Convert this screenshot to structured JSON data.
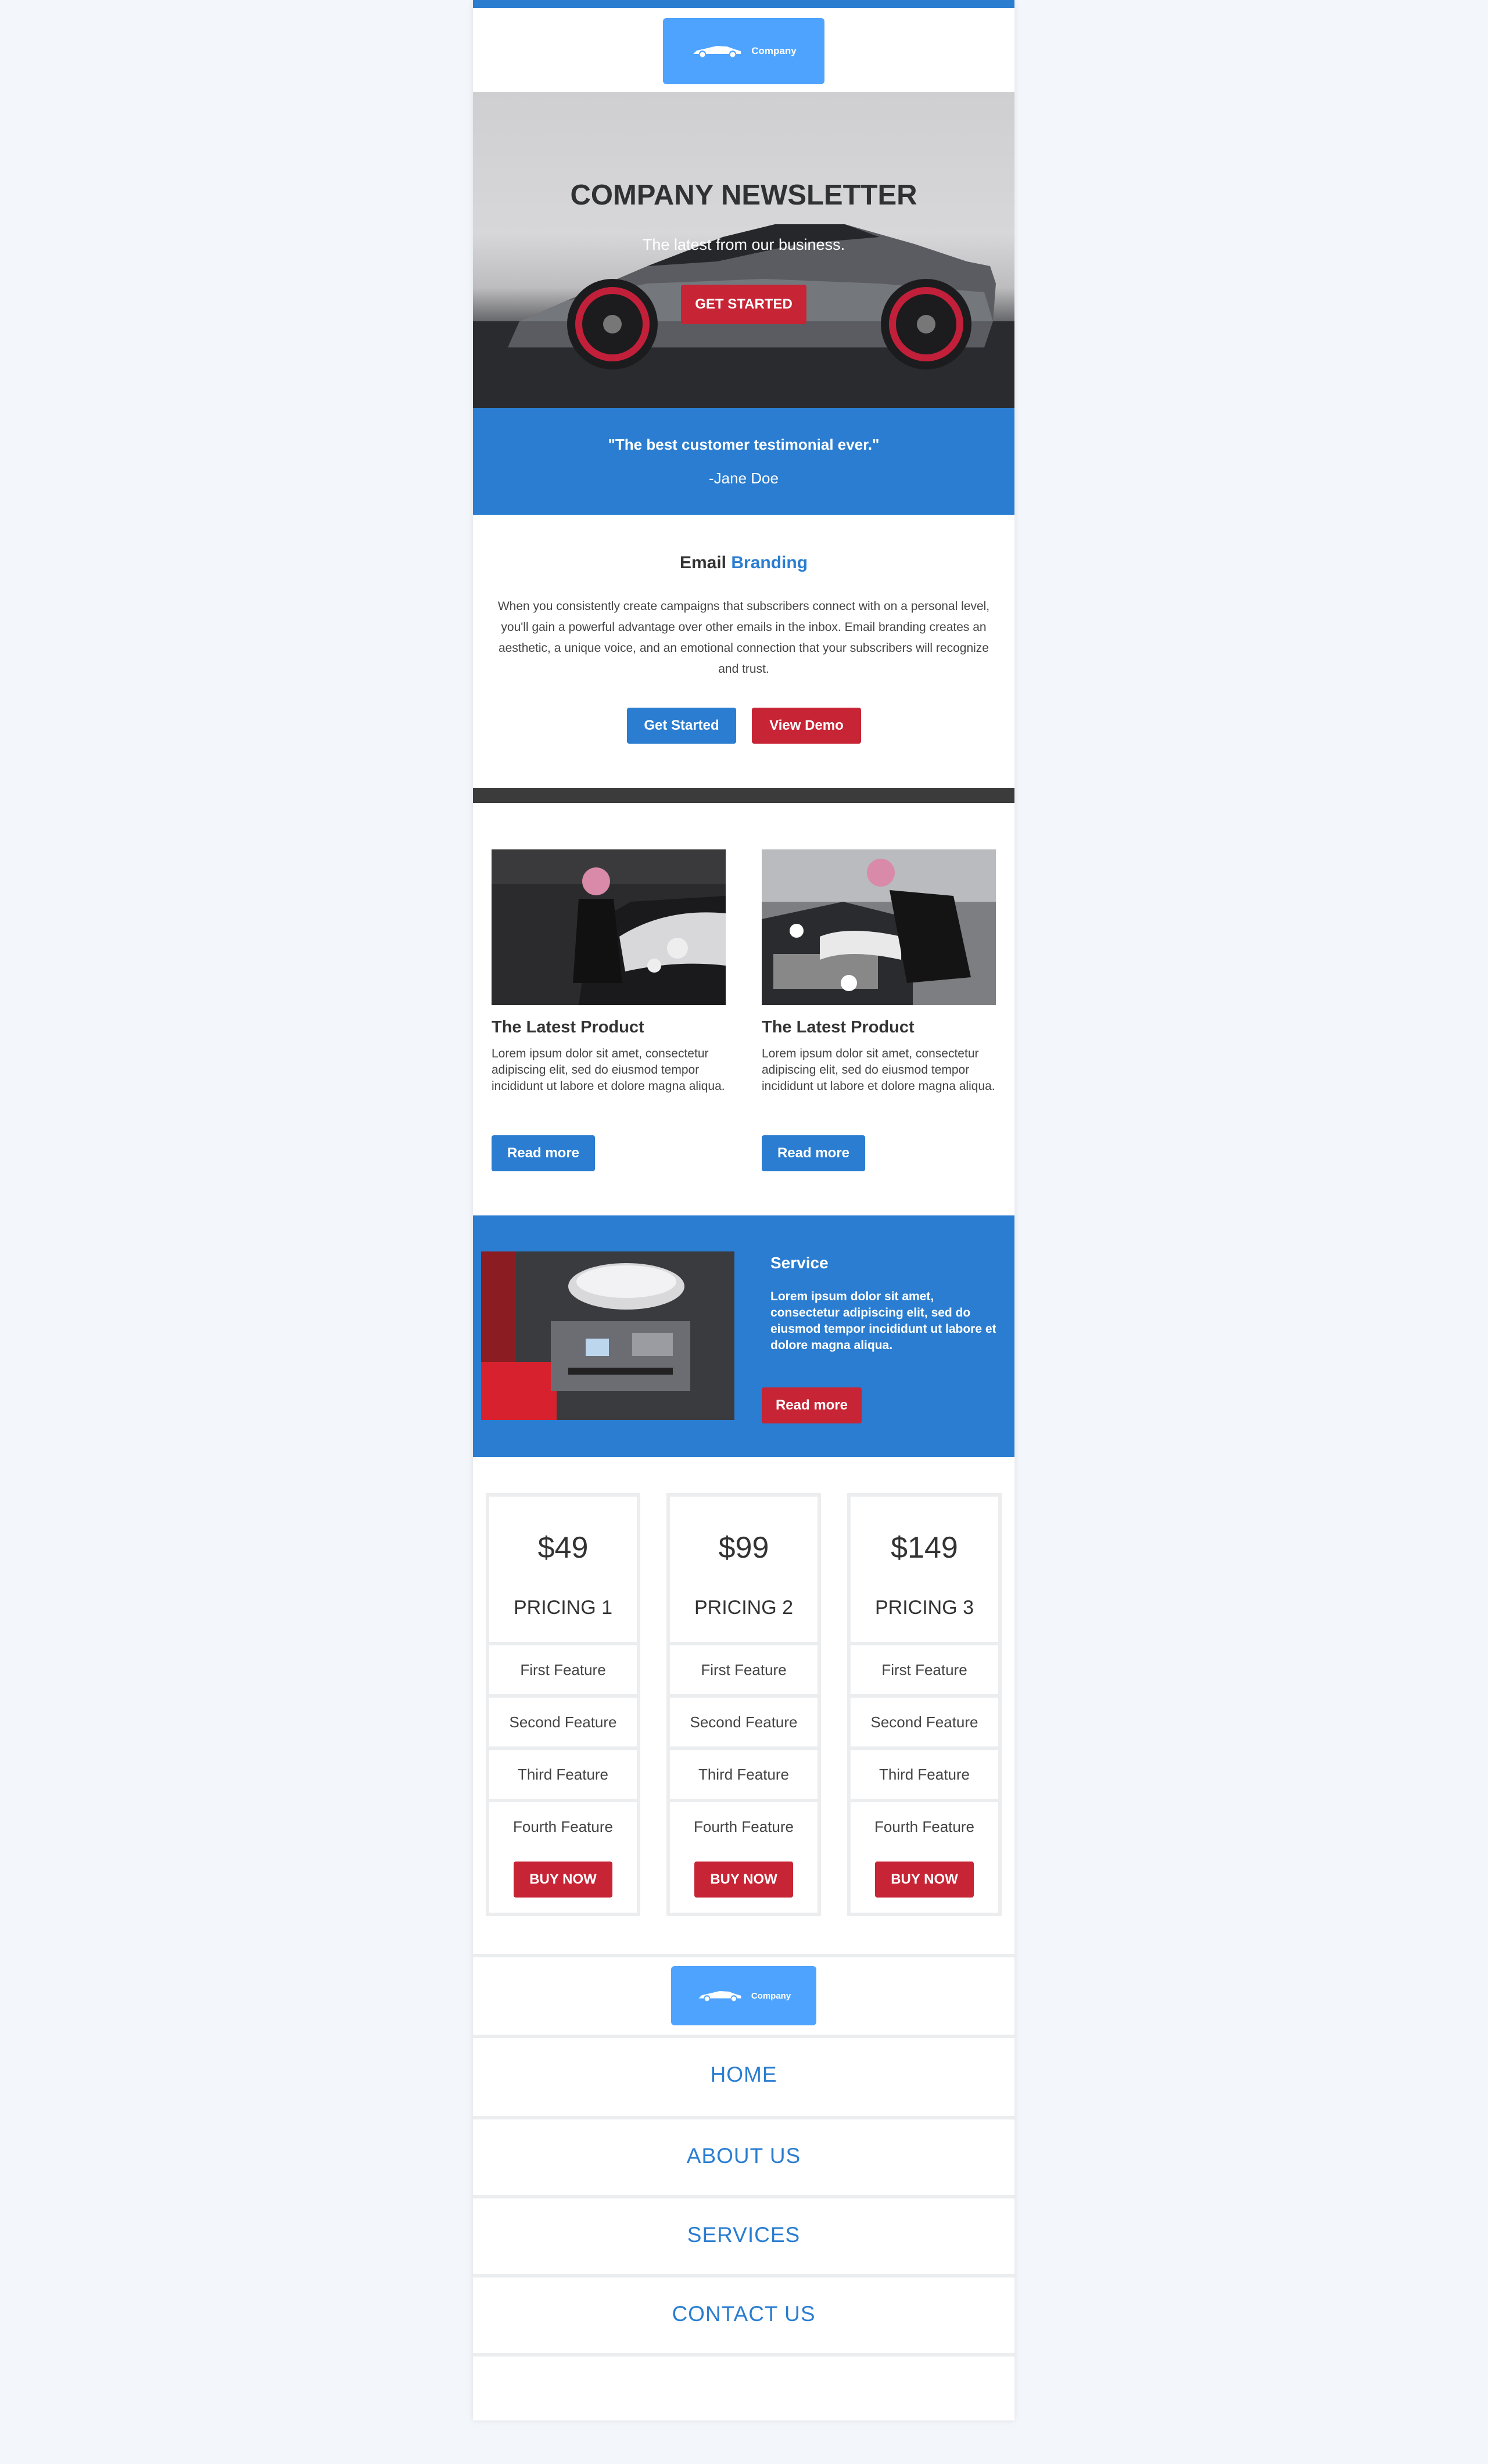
{
  "brand": {
    "logo_text": "Company",
    "logo_icon": "car-icon",
    "colors": {
      "primary": "#2a7dd0",
      "accent": "#c72435",
      "logo_bg": "#4ea3ff",
      "dark": "#3b3b3b",
      "page_bg": "#f3f7fb"
    }
  },
  "hero": {
    "title": "COMPANY NEWSLETTER",
    "subtitle": "The latest from our business.",
    "button": "GET STARTED"
  },
  "testimonial": {
    "quote": "\"The best customer testimonial ever.\"",
    "author": "-Jane Doe"
  },
  "branding": {
    "title_plain": "Email",
    "title_accent": "Branding",
    "body": "When you consistently create campaigns that subscribers connect with on a personal level, you'll gain a powerful advantage over other emails in the inbox. Email branding creates an aesthetic, a unique voice, and an emotional connection that your subscribers will recognize and trust.",
    "primary_button": "Get Started",
    "secondary_button": "View Demo"
  },
  "products": [
    {
      "title": "The Latest Product",
      "body": "Lorem ipsum dolor sit amet, consectetur adipiscing elit, sed do eiusmod tempor incididunt ut labore et dolore magna aliqua.",
      "button": "Read more"
    },
    {
      "title": "The Latest Product",
      "body": "Lorem ipsum dolor sit amet, consectetur adipiscing elit, sed do eiusmod tempor incididunt ut labore et dolore magna aliqua.",
      "button": "Read more"
    }
  ],
  "service": {
    "title": "Service",
    "body": "Lorem ipsum dolor sit amet, consectetur adipiscing elit, sed do eiusmod tempor incididunt ut labore et dolore magna aliqua.",
    "button": "Read more"
  },
  "pricing": [
    {
      "price": "$49",
      "name": "PRICING 1",
      "features": [
        "First Feature",
        "Second Feature",
        "Third Feature",
        "Fourth Feature"
      ],
      "button": "BUY NOW"
    },
    {
      "price": "$99",
      "name": "PRICING 2",
      "features": [
        "First Feature",
        "Second Feature",
        "Third Feature",
        "Fourth Feature"
      ],
      "button": "BUY NOW"
    },
    {
      "price": "$149",
      "name": "PRICING 3",
      "features": [
        "First Feature",
        "Second Feature",
        "Third Feature",
        "Fourth Feature"
      ],
      "button": "BUY NOW"
    }
  ],
  "footer": {
    "nav": [
      "HOME",
      "ABOUT US",
      "SERVICES",
      "CONTACT US"
    ]
  }
}
